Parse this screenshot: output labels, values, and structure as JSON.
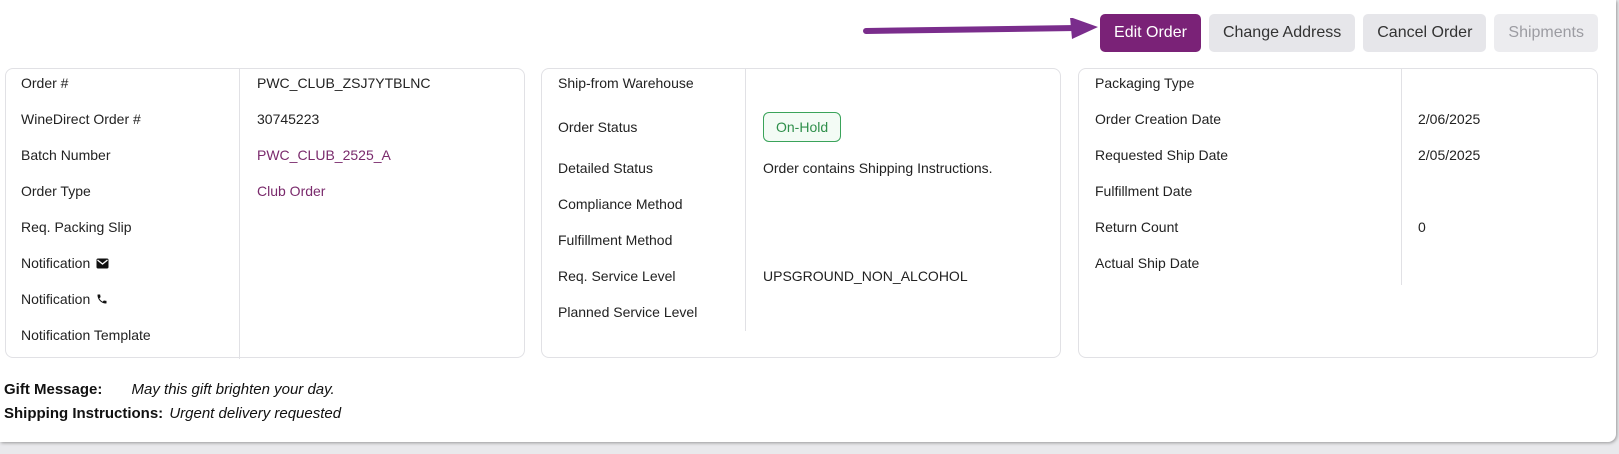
{
  "toolbar": {
    "edit_order": "Edit Order",
    "change_address": "Change Address",
    "cancel_order": "Cancel Order",
    "shipments": "Shipments"
  },
  "colors": {
    "primary": "#7a2277",
    "arrow": "#7a2d8c",
    "status_green": "#2f8f4b",
    "link": "#7a2a6c"
  },
  "order_panel": {
    "rows": [
      {
        "label": "Order #",
        "value": "PWC_CLUB_ZSJ7YTBLNC"
      },
      {
        "label": "WineDirect Order #",
        "value": "30745223"
      },
      {
        "label": "Batch Number",
        "value": "PWC_CLUB_2525_A"
      },
      {
        "label": "Order Type",
        "value": "Club Order"
      },
      {
        "label": "Req. Packing Slip",
        "value": ""
      },
      {
        "label": "Notification",
        "value": "",
        "icon": "envelope-icon"
      },
      {
        "label": "Notification",
        "value": "",
        "icon": "phone-icon"
      },
      {
        "label": "Notification Template",
        "value": ""
      }
    ]
  },
  "shipping_panel": {
    "rows": [
      {
        "label": "Ship-from Warehouse",
        "value": ""
      },
      {
        "label": "Order Status",
        "value": "On-Hold"
      },
      {
        "label": "Detailed Status",
        "value": "Order contains Shipping Instructions."
      },
      {
        "label": "Compliance Method",
        "value": ""
      },
      {
        "label": "Fulfillment Method",
        "value": ""
      },
      {
        "label": "Req. Service Level",
        "value": "UPSGROUND_NON_ALCOHOL"
      },
      {
        "label": "Planned Service Level",
        "value": ""
      }
    ]
  },
  "dates_panel": {
    "rows": [
      {
        "label": "Packaging Type",
        "value": ""
      },
      {
        "label": "Order Creation Date",
        "value": "2/06/2025"
      },
      {
        "label": "Requested Ship Date",
        "value": "2/05/2025"
      },
      {
        "label": "Fulfillment Date",
        "value": ""
      },
      {
        "label": "Return Count",
        "value": "0"
      },
      {
        "label": "Actual Ship Date",
        "value": ""
      }
    ]
  },
  "messages": {
    "gift_label": "Gift Message:",
    "gift_value": "May this gift brighten your day.",
    "shipping_label": "Shipping Instructions:",
    "shipping_value": "Urgent delivery requested"
  }
}
